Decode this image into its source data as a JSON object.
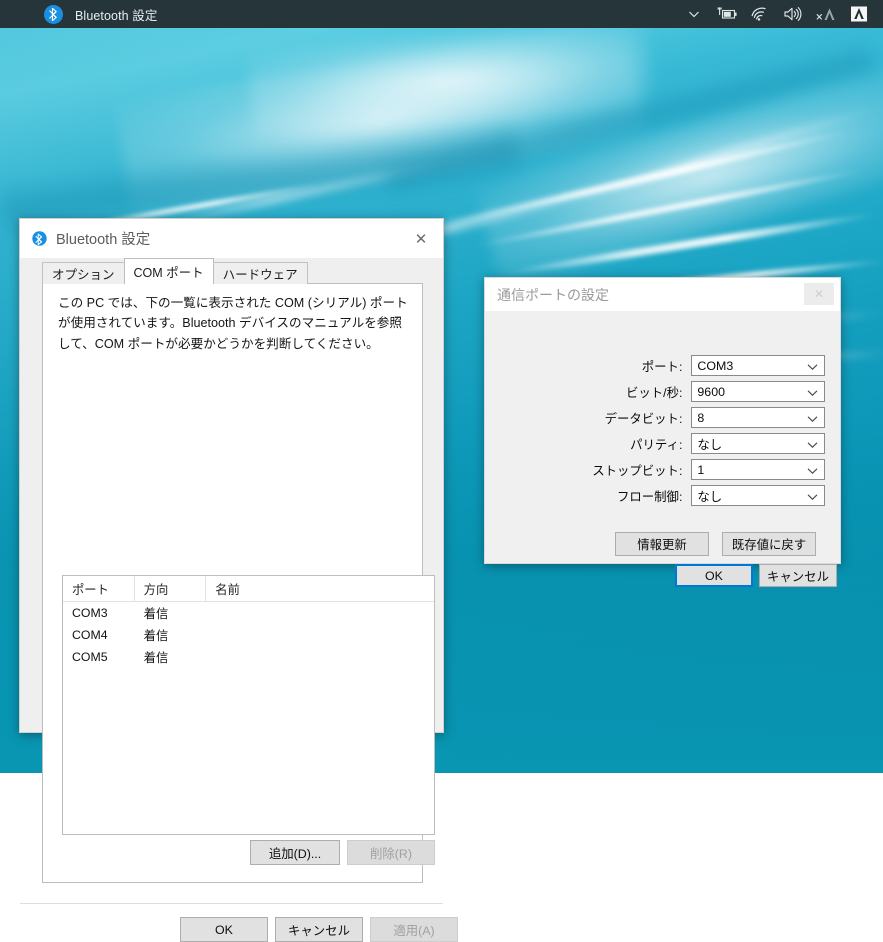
{
  "taskbar": {
    "app_icon": "bluetooth-icon",
    "title": "Bluetooth 設定",
    "tray": [
      {
        "name": "chevron-up-overflow-icon",
        "label": "⌄"
      },
      {
        "name": "battery-charging-icon",
        "label": "battery"
      },
      {
        "name": "wifi-icon",
        "label": "wifi"
      },
      {
        "name": "volume-icon",
        "label": "volume"
      },
      {
        "name": "app-a-muted-icon",
        "label": "A"
      },
      {
        "name": "app-a-icon",
        "label": "A"
      }
    ]
  },
  "bluetooth_dialog": {
    "title": "Bluetooth 設定",
    "title_icon": "bluetooth-icon",
    "close_label": "✕",
    "tabs": [
      {
        "label": "オプション",
        "active": false
      },
      {
        "label": "COM ポート",
        "active": true
      },
      {
        "label": "ハードウェア",
        "active": false
      }
    ],
    "description": "この PC では、下の一覧に表示された COM (シリアル) ポートが使用されています。Bluetooth デバイスのマニュアルを参照して、COM ポートが必要かどうかを判断してください。",
    "table": {
      "columns": [
        "ポート",
        "方向",
        "名前"
      ],
      "rows": [
        {
          "port": "COM3",
          "direction": "着信",
          "name": ""
        },
        {
          "port": "COM4",
          "direction": "着信",
          "name": ""
        },
        {
          "port": "COM5",
          "direction": "着信",
          "name": ""
        }
      ]
    },
    "list_buttons": {
      "add": "追加(D)...",
      "remove": "削除(R)"
    },
    "footer_buttons": {
      "ok": "OK",
      "cancel": "キャンセル",
      "apply": "適用(A)"
    }
  },
  "com_dialog": {
    "title": "通信ポートの設定",
    "close_label": "✕",
    "fields": [
      {
        "label": "ポート:",
        "value": "COM3"
      },
      {
        "label": "ビット/秒:",
        "value": "9600"
      },
      {
        "label": "データビット:",
        "value": "8"
      },
      {
        "label": "パリティ:",
        "value": "なし"
      },
      {
        "label": "ストップビット:",
        "value": "1"
      },
      {
        "label": "フロー制御:",
        "value": "なし"
      }
    ],
    "buttons": {
      "refresh": "情報更新",
      "restore": "既存値に戻す",
      "ok": "OK",
      "cancel": "キャンセル"
    }
  },
  "colors": {
    "taskbar_bg": "#26353a",
    "accent_blue": "#0078d7",
    "bluetooth_blue": "#1a8fe0",
    "dialog_bg": "#efefef",
    "wallpaper_teal": "#0d93ad"
  }
}
